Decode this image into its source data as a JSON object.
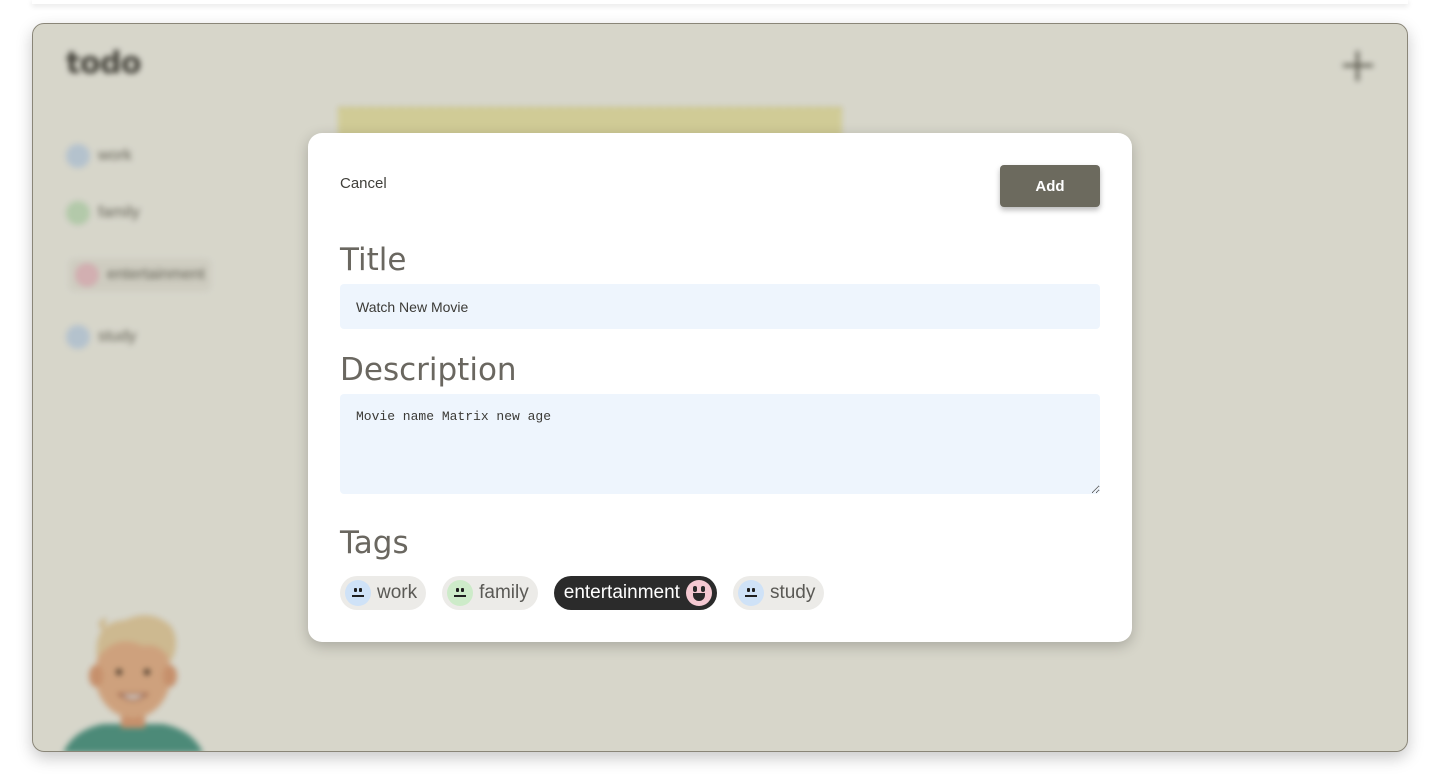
{
  "app": {
    "logo": "todo",
    "add_icon": "plus-icon",
    "sidebar": [
      {
        "label": "work",
        "color": "#cfe2f7"
      },
      {
        "label": "family",
        "color": "#cdebc9"
      },
      {
        "label": "entertainment",
        "color": "#f5c9d2"
      },
      {
        "label": "study",
        "color": "#cfe2f7"
      }
    ]
  },
  "modal": {
    "cancel_label": "Cancel",
    "add_label": "Add",
    "title_label": "Title",
    "title_value": "Watch New Movie",
    "description_label": "Description",
    "description_value": "Movie name Matrix new age",
    "tags_label": "Tags",
    "tags": [
      {
        "label": "work",
        "face_color": "#cfe2f7",
        "selected": false
      },
      {
        "label": "family",
        "face_color": "#cdebc9",
        "selected": false
      },
      {
        "label": "entertainment",
        "face_color": "#f5c9d2",
        "selected": true
      },
      {
        "label": "study",
        "face_color": "#cfe2f7",
        "selected": false
      }
    ]
  },
  "colors": {
    "accent_button": "#6c6a5e",
    "selected_tag": "#2b2b2b",
    "input_bg": "#eef5fd"
  }
}
